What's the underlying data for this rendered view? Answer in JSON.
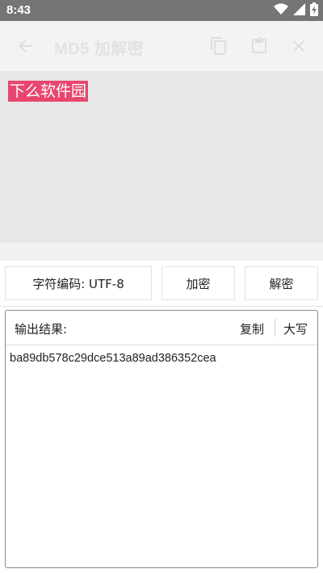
{
  "status_bar": {
    "time": "8:43",
    "icons": [
      "wifi-icon",
      "signal-icon",
      "battery-charging-icon"
    ]
  },
  "app_bar": {
    "title": "MD5 加解密",
    "icons": [
      "back-arrow-icon",
      "copy-icon",
      "clipboard-icon",
      "close-icon"
    ]
  },
  "input": {
    "text": "下么软件园",
    "highlight_color": "#e8466f"
  },
  "actions": {
    "encoding_label": "字符编码: UTF-8",
    "encrypt_label": "加密",
    "decrypt_label": "解密"
  },
  "output": {
    "label": "输出结果:",
    "copy_label": "复制",
    "uppercase_label": "大写",
    "value": "ba89db578c29dce513a89ad386352cea"
  }
}
